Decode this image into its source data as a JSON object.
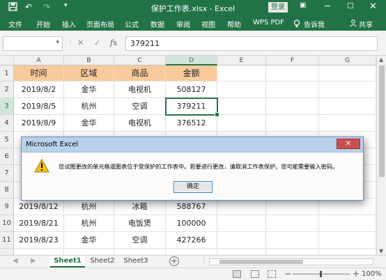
{
  "titlebar": {
    "title": "保护工作表.xlsx  -  Excel",
    "login_label": "登录",
    "save_icon": "save-icon",
    "undo_icon": "undo-icon",
    "redo_icon": "redo-icon"
  },
  "ribbon": {
    "tabs": [
      "文件",
      "开始",
      "插入",
      "页面布局",
      "公式",
      "数据",
      "审阅",
      "视图",
      "帮助",
      "WPS PDF"
    ],
    "tell_me": "告诉我",
    "share": "共享"
  },
  "formula_bar": {
    "name_box": "",
    "formula_value": "379211",
    "fx_label": "fx"
  },
  "columns": [
    "A",
    "B",
    "C",
    "D",
    "E",
    "F",
    "G"
  ],
  "selected_column": "D",
  "rows": [
    "1",
    "2",
    "3",
    "4",
    "5",
    "6",
    "7",
    "8",
    "9",
    "10",
    "11"
  ],
  "selected_row": "3",
  "table": {
    "headers": [
      "时间",
      "区域",
      "商品",
      "金额"
    ],
    "data": [
      [
        "2019/8/2",
        "金华",
        "电视机",
        "508127"
      ],
      [
        "2019/8/5",
        "杭州",
        "空调",
        "379211"
      ],
      [
        "2019/8/9",
        "金华",
        "电视机",
        "376512"
      ],
      [
        "",
        "",
        "",
        ""
      ],
      [
        "",
        "",
        "",
        ""
      ],
      [
        "",
        "",
        "",
        ""
      ],
      [
        "",
        "",
        "",
        ""
      ],
      [
        "2019/8/12",
        "杭州",
        "冰箱",
        "588767"
      ],
      [
        "2019/8/21",
        "杭州",
        "电饭煲",
        "100000"
      ],
      [
        "2019/8/23",
        "金华",
        "空调",
        "427266"
      ]
    ]
  },
  "sheets": [
    "Sheet1",
    "Sheet2",
    "Sheet3"
  ],
  "active_sheet": "Sheet1",
  "status": {
    "zoom": "100%"
  },
  "dialog": {
    "title": "Microsoft Excel",
    "message": "您试图更改的单元格或图表位于受保护的工作表中。若要进行更改，请取消工作表保护。您可能需要输入密码。",
    "ok_label": "确定",
    "icon": "warning-icon"
  },
  "colors": {
    "excel_green": "#217346",
    "header_fill": "#f9cb9c"
  }
}
